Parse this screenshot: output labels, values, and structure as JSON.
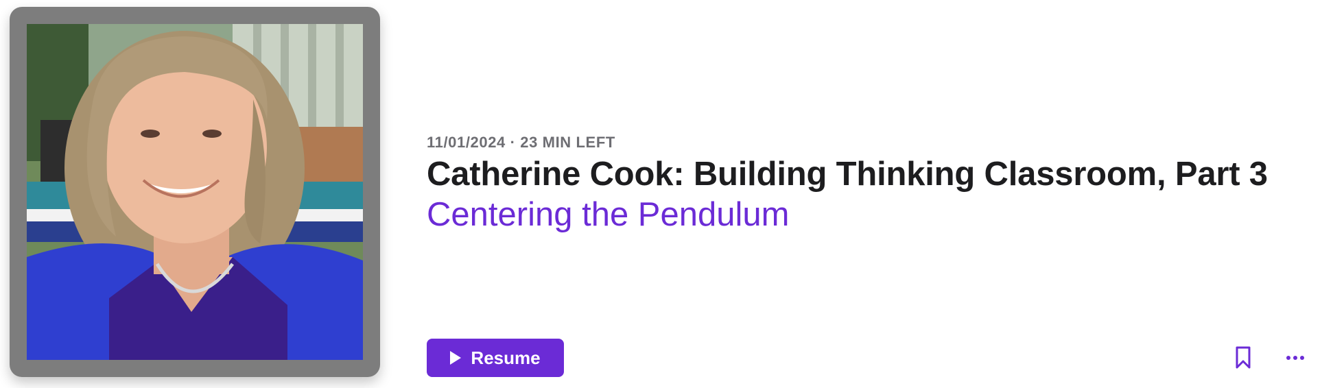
{
  "episode": {
    "date": "11/01/2024",
    "separator": "·",
    "time_left": "23 MIN LEFT",
    "title": "Catherine Cook: Building Thinking Classroom, Part 3",
    "subtitle": "Centering the Pendulum"
  },
  "actions": {
    "resume_label": "Resume",
    "play_icon": "play-icon",
    "bookmark_icon": "bookmark-icon",
    "more_icon": "more-icon"
  },
  "artwork": {
    "description_icon": "episode-artwork"
  },
  "colors": {
    "accent": "#6b2bd6",
    "title": "#1d1d1f",
    "meta": "#6e6e73",
    "frame": "#7d7d7d"
  }
}
